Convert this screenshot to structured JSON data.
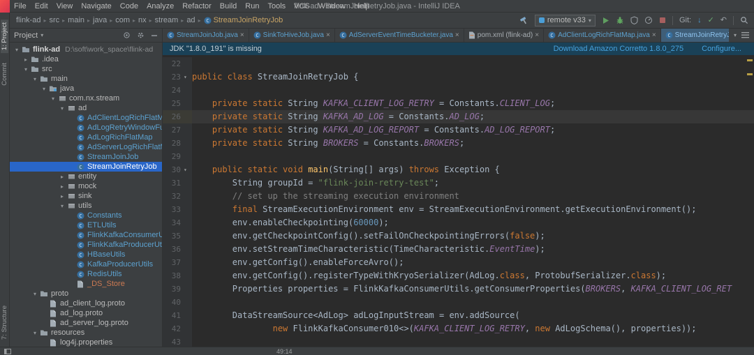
{
  "title_bar": {
    "title": "flink-ad - StreamJoinRetryJob.java - IntelliJ IDEA"
  },
  "menu": {
    "items": [
      "File",
      "Edit",
      "View",
      "Navigate",
      "Code",
      "Analyze",
      "Refactor",
      "Build",
      "Run",
      "Tools",
      "VCS",
      "Window",
      "Help"
    ]
  },
  "toolbar": {
    "breadcrumbs": [
      "flink-ad",
      "src",
      "main",
      "java",
      "com",
      "nx",
      "stream",
      "ad"
    ],
    "breadcrumb_current": "StreamJoinRetryJob",
    "run_config": "remote v33",
    "git_label": "Git:",
    "left_icons": [
      "hammer"
    ],
    "run_icons": [
      "play",
      "debug",
      "coverage",
      "profiler",
      "stop"
    ],
    "git_icons": [
      "git-update",
      "git-commit",
      "git-revert"
    ],
    "end_icons": [
      "search"
    ]
  },
  "stripe": {
    "top": [
      "1: Project",
      "Commit"
    ],
    "bottom": [
      "7: Structure"
    ]
  },
  "project_panel": {
    "title": "Project",
    "header_icons": [
      "locate",
      "gear",
      "hide"
    ],
    "tree": [
      {
        "label": "flink-ad",
        "hint": "D:\\soft\\work_space\\flink-ad",
        "level": 0,
        "arrow": "down",
        "icon": "module",
        "style": "bold"
      },
      {
        "label": ".idea",
        "level": 1,
        "arrow": "right",
        "icon": "folder"
      },
      {
        "label": "src",
        "level": 1,
        "arrow": "down",
        "icon": "folder"
      },
      {
        "label": "main",
        "level": 2,
        "arrow": "down",
        "icon": "folder"
      },
      {
        "label": "java",
        "level": 3,
        "arrow": "down",
        "icon": "folder-src"
      },
      {
        "label": "com.nx.stream",
        "level": 4,
        "arrow": "down",
        "icon": "package"
      },
      {
        "label": "ad",
        "level": 5,
        "arrow": "down",
        "icon": "package"
      },
      {
        "label": "AdClientLogRichFlatMap",
        "level": 6,
        "icon": "class",
        "style": "modified"
      },
      {
        "label": "AdLogRetryWindowFunction",
        "level": 6,
        "icon": "class",
        "style": "modified"
      },
      {
        "label": "AdLogRichFlatMap",
        "level": 6,
        "icon": "class",
        "style": "modified"
      },
      {
        "label": "AdServerLogRichFlatMap",
        "level": 6,
        "icon": "class",
        "style": "modified"
      },
      {
        "label": "StreamJoinJob",
        "level": 6,
        "icon": "class",
        "style": "modified"
      },
      {
        "label": "StreamJoinRetryJob",
        "level": 6,
        "icon": "class",
        "style": "modified",
        "selected": true
      },
      {
        "label": "entity",
        "level": 5,
        "arrow": "right",
        "icon": "package"
      },
      {
        "label": "mock",
        "level": 5,
        "arrow": "right",
        "icon": "package"
      },
      {
        "label": "sink",
        "level": 5,
        "arrow": "right",
        "icon": "package"
      },
      {
        "label": "utils",
        "level": 5,
        "arrow": "down",
        "icon": "package"
      },
      {
        "label": "Constants",
        "level": 6,
        "icon": "class",
        "style": "modified"
      },
      {
        "label": "ETLUtils",
        "level": 6,
        "icon": "class",
        "style": "modified"
      },
      {
        "label": "FlinkKafkaConsumerUtils",
        "level": 6,
        "icon": "class",
        "style": "modified"
      },
      {
        "label": "FlinkKafkaProducerUtils",
        "level": 6,
        "icon": "class",
        "style": "modified"
      },
      {
        "label": "HBaseUtils",
        "level": 6,
        "icon": "class",
        "style": "modified"
      },
      {
        "label": "KafkaProducerUtils",
        "level": 6,
        "icon": "class",
        "style": "modified"
      },
      {
        "label": "RedisUtils",
        "level": 6,
        "icon": "class",
        "style": "modified"
      },
      {
        "label": "_DS_Store",
        "level": 6,
        "icon": "file",
        "style": "unversioned"
      },
      {
        "label": "proto",
        "level": 2,
        "arrow": "down",
        "icon": "folder"
      },
      {
        "label": "ad_client_log.proto",
        "level": 3,
        "icon": "file"
      },
      {
        "label": "ad_log.proto",
        "level": 3,
        "icon": "file"
      },
      {
        "label": "ad_server_log.proto",
        "level": 3,
        "icon": "file"
      },
      {
        "label": "resources",
        "level": 2,
        "arrow": "down",
        "icon": "folder"
      },
      {
        "label": "log4j.properties",
        "level": 3,
        "icon": "file"
      }
    ]
  },
  "notification": {
    "text": "JDK \"1.8.0_191\" is missing",
    "download_link": "Download Amazon Corretto 1.8.0_275",
    "configure_link": "Configure..."
  },
  "tabs": [
    {
      "label": "StreamJoinJob.java",
      "icon": "class",
      "modified": true
    },
    {
      "label": "SinkToHiveJob.java",
      "icon": "class",
      "modified": true
    },
    {
      "label": "AdServerEventTimeBucketer.java",
      "icon": "class",
      "modified": true
    },
    {
      "label": "pom.xml (flink-ad)",
      "icon": "xml",
      "modified": false
    },
    {
      "label": "AdClientLogRichFlatMap.java",
      "icon": "class",
      "modified": true
    },
    {
      "label": "StreamJoinRetryJob.java",
      "icon": "class",
      "modified": true,
      "active": true
    }
  ],
  "editor": {
    "current_line": 26,
    "lines": [
      {
        "n": 22,
        "tk": []
      },
      {
        "n": 23,
        "fold": true,
        "tk": [
          [
            "k",
            "public class "
          ],
          [
            "t",
            "StreamJoinRetryJob {"
          ]
        ]
      },
      {
        "n": 24,
        "tk": []
      },
      {
        "n": 25,
        "tk": [
          [
            "t",
            "    "
          ],
          [
            "k",
            "private static "
          ],
          [
            "t",
            "String "
          ],
          [
            "f",
            "KAFKA_CLIENT_LOG_RETRY"
          ],
          [
            "t",
            " = Constants."
          ],
          [
            "f",
            "CLIENT_LOG"
          ],
          [
            "t",
            ";"
          ]
        ]
      },
      {
        "n": 26,
        "tk": [
          [
            "t",
            "    "
          ],
          [
            "k",
            "private static "
          ],
          [
            "t",
            "String "
          ],
          [
            "f",
            "KAFKA_AD_LOG"
          ],
          [
            "t",
            " = Constants."
          ],
          [
            "f",
            "AD_LOG"
          ],
          [
            "t",
            ";"
          ]
        ]
      },
      {
        "n": 27,
        "tk": [
          [
            "t",
            "    "
          ],
          [
            "k",
            "private static "
          ],
          [
            "t",
            "String "
          ],
          [
            "f",
            "KAFKA_AD_LOG_REPORT"
          ],
          [
            "t",
            " = Constants."
          ],
          [
            "f",
            "AD_LOG_REPORT"
          ],
          [
            "t",
            ";"
          ]
        ]
      },
      {
        "n": 28,
        "tk": [
          [
            "t",
            "    "
          ],
          [
            "k",
            "private static "
          ],
          [
            "t",
            "String "
          ],
          [
            "f",
            "BROKERS"
          ],
          [
            "t",
            " = Constants."
          ],
          [
            "f",
            "BROKERS"
          ],
          [
            "t",
            ";"
          ]
        ]
      },
      {
        "n": 29,
        "tk": []
      },
      {
        "n": 30,
        "fold": true,
        "tk": [
          [
            "t",
            "    "
          ],
          [
            "k",
            "public static void "
          ],
          [
            "m",
            "main"
          ],
          [
            "t",
            "(String[] args) "
          ],
          [
            "k",
            "throws "
          ],
          [
            "t",
            "Exception {"
          ]
        ]
      },
      {
        "n": 31,
        "tk": [
          [
            "t",
            "        String groupId = "
          ],
          [
            "s",
            "\"flink-join-retry-test\""
          ],
          [
            "t",
            ";"
          ]
        ]
      },
      {
        "n": 32,
        "tk": [
          [
            "c",
            "        // set up the streaming execution environment"
          ]
        ]
      },
      {
        "n": 33,
        "tk": [
          [
            "t",
            "        "
          ],
          [
            "k",
            "final "
          ],
          [
            "t",
            "StreamExecutionEnvironment env = StreamExecutionEnvironment.getExecutionEnvironment();"
          ]
        ]
      },
      {
        "n": 34,
        "tk": [
          [
            "t",
            "        env.enableCheckpointing("
          ],
          [
            "n2",
            "60000"
          ],
          [
            "t",
            ");"
          ]
        ]
      },
      {
        "n": 35,
        "tk": [
          [
            "t",
            "        env.getCheckpointConfig().setFailOnCheckpointingErrors("
          ],
          [
            "k",
            "false"
          ],
          [
            "t",
            ");"
          ]
        ]
      },
      {
        "n": 36,
        "tk": [
          [
            "t",
            "        env.setStreamTimeCharacteristic(TimeCharacteristic."
          ],
          [
            "f",
            "EventTime"
          ],
          [
            "t",
            ");"
          ]
        ]
      },
      {
        "n": 37,
        "tk": [
          [
            "t",
            "        env.getConfig().enableForceAvro();"
          ]
        ]
      },
      {
        "n": 38,
        "tk": [
          [
            "t",
            "        env.getConfig().registerTypeWithKryoSerializer(AdLog."
          ],
          [
            "k",
            "class"
          ],
          [
            "t",
            ", ProtobufSerializer."
          ],
          [
            "k",
            "class"
          ],
          [
            "t",
            ");"
          ]
        ]
      },
      {
        "n": 39,
        "tk": [
          [
            "t",
            "        Properties properties = FlinkKafkaConsumerUtils.getConsumerProperties("
          ],
          [
            "f",
            "BROKERS"
          ],
          [
            "t",
            ", "
          ],
          [
            "f",
            "KAFKA_CLIENT_LOG_RET"
          ]
        ]
      },
      {
        "n": 40,
        "tk": []
      },
      {
        "n": 41,
        "tk": [
          [
            "t",
            "        DataStreamSource<AdLog> adLogInputStream = env.addSource("
          ]
        ]
      },
      {
        "n": 42,
        "tk": [
          [
            "t",
            "                "
          ],
          [
            "k",
            "new "
          ],
          [
            "t",
            "FlinkKafkaConsumer010<>("
          ],
          [
            "f",
            "KAFKA_CLIENT_LOG_RETRY"
          ],
          [
            "t",
            ", "
          ],
          [
            "k",
            "new "
          ],
          [
            "t",
            "AdLogSchema(), properties));"
          ]
        ]
      },
      {
        "n": 43,
        "tk": []
      }
    ]
  },
  "status_bar": {
    "message": "49:14"
  },
  "colors": {
    "editor_bg": "#2b2b2b",
    "panel_bg": "#3c3f41",
    "selection_blue": "#2966c8",
    "modified_file": "#5ca1cf",
    "unversioned_file": "#cc7a52",
    "keyword": "#cc7832",
    "string": "#6a8759",
    "comment": "#808080",
    "number": "#6897bb",
    "field": "#9876aa",
    "link": "#46a2de",
    "notification_bg": "#1a4157",
    "active_tab_bg": "#3f5e78"
  }
}
